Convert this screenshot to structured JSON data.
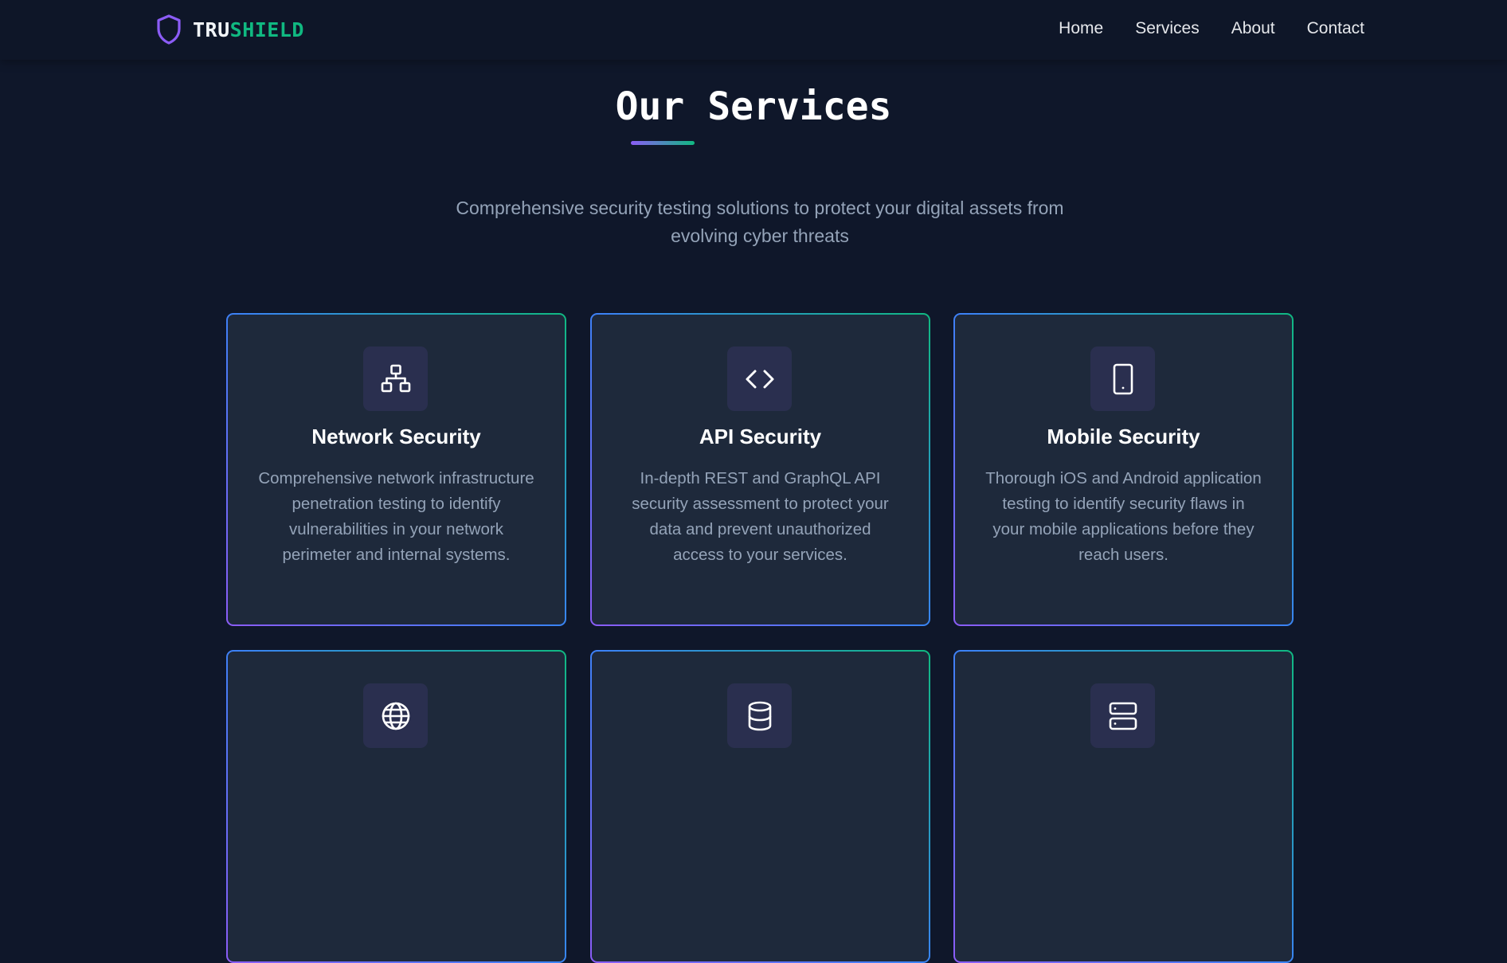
{
  "nav": {
    "brand_prefix": "TRU",
    "brand_suffix": "SHIELD",
    "brand_icon": "shield-icon",
    "links": [
      "Home",
      "Services",
      "About",
      "Contact"
    ]
  },
  "services": {
    "title": "Our Services",
    "subtitle": "Comprehensive security testing solutions to protect your digital assets from evolving cyber threats",
    "cards": [
      {
        "icon": "network-icon",
        "title": "Network Security",
        "description": "Comprehensive network infrastructure penetration testing to identify vulnerabilities in your network perimeter and internal systems."
      },
      {
        "icon": "code-icon",
        "title": "API Security",
        "description": "In-depth REST and GraphQL API security assessment to protect your data and prevent unauthorized access to your services."
      },
      {
        "icon": "mobile-icon",
        "title": "Mobile Security",
        "description": "Thorough iOS and Android application testing to identify security flaws in your mobile applications before they reach users."
      },
      {
        "icon": "globe-icon"
      },
      {
        "icon": "database-icon"
      },
      {
        "icon": "server-icon"
      }
    ]
  },
  "colors": {
    "background": "#0f172a",
    "card": "#1e293b",
    "accent_purple": "#8b5cf6",
    "accent_green": "#10b981",
    "muted_text": "#94a3b8"
  }
}
